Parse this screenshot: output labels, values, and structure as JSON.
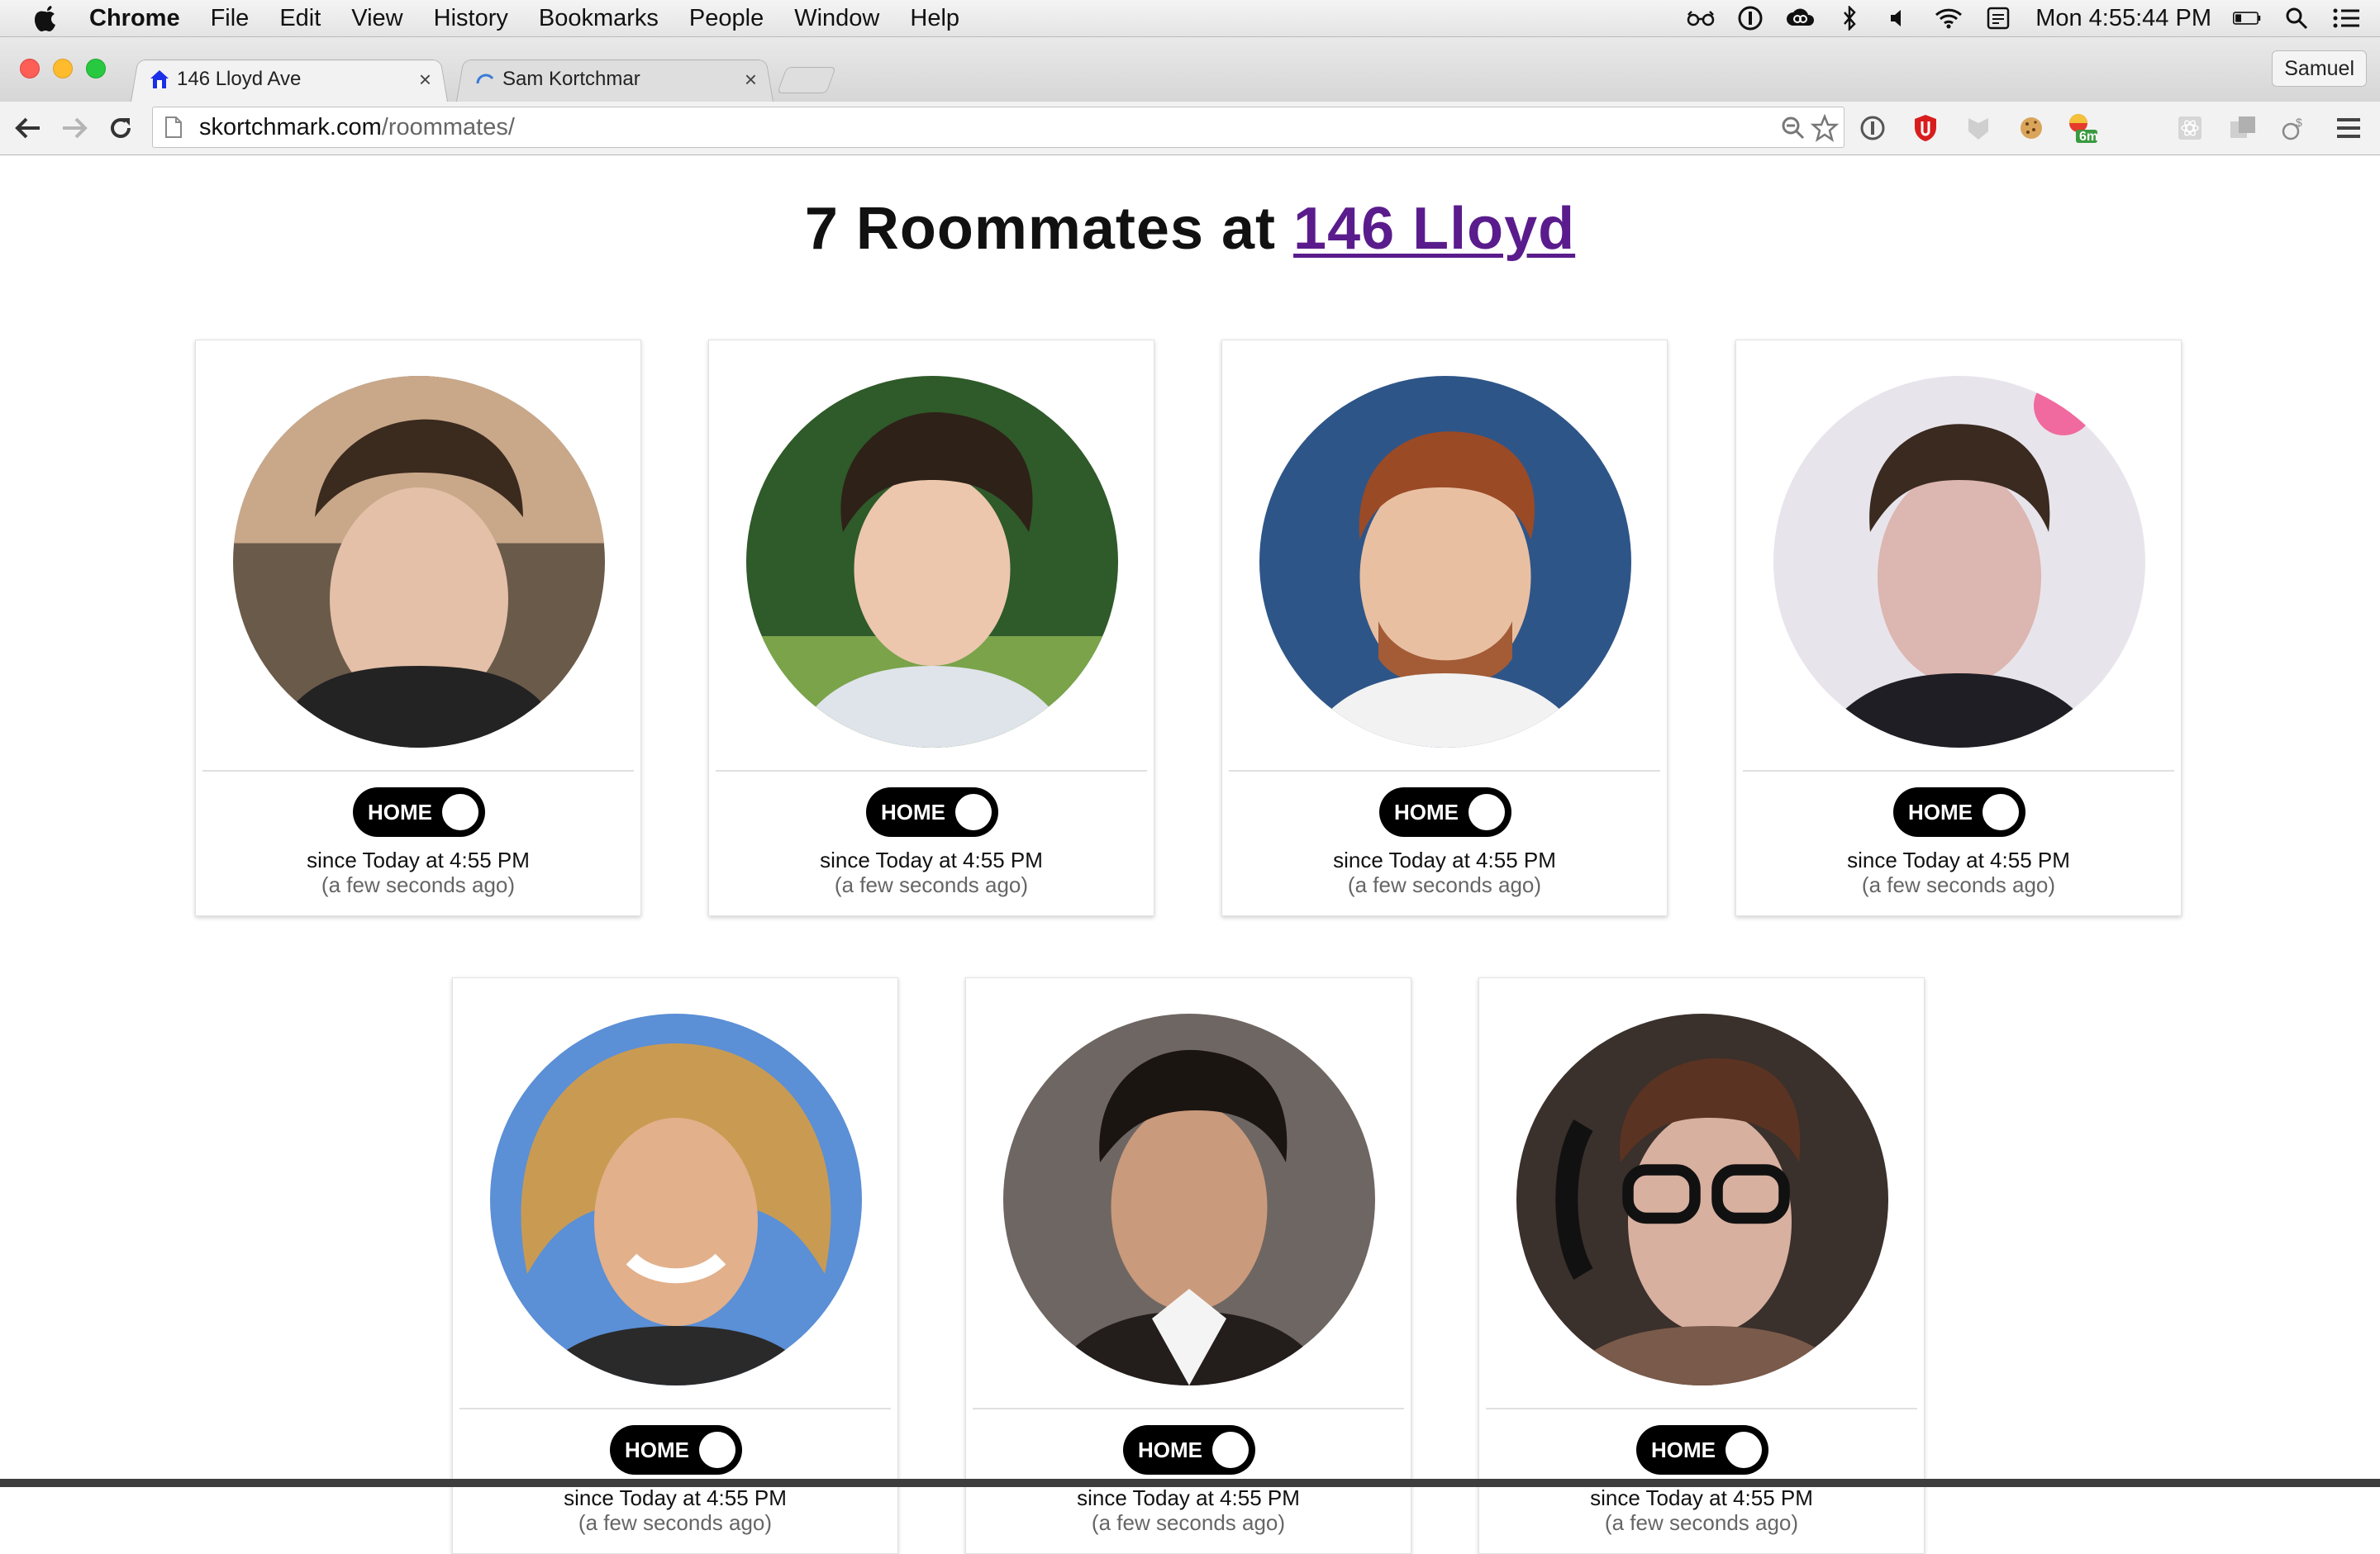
{
  "menubar": {
    "items": [
      "Chrome",
      "File",
      "Edit",
      "View",
      "History",
      "Bookmarks",
      "People",
      "Window",
      "Help"
    ],
    "clock": "Mon 4:55:44 PM"
  },
  "tabs": [
    {
      "title": "146 Lloyd Ave"
    },
    {
      "title": "Sam Kortchmar"
    }
  ],
  "profile_name": "Samuel",
  "omnibox": {
    "domain": "skortchmark.com",
    "path": "/roommates/"
  },
  "extensions": {
    "badge": "6m"
  },
  "page": {
    "title_prefix": "7 Roommates at ",
    "title_link": "146 Lloyd"
  },
  "roommates": [
    {
      "status": "HOME",
      "since": "since Today at 4:55 PM",
      "ago": "(a few seconds ago)"
    },
    {
      "status": "HOME",
      "since": "since Today at 4:55 PM",
      "ago": "(a few seconds ago)"
    },
    {
      "status": "HOME",
      "since": "since Today at 4:55 PM",
      "ago": "(a few seconds ago)"
    },
    {
      "status": "HOME",
      "since": "since Today at 4:55 PM",
      "ago": "(a few seconds ago)"
    },
    {
      "status": "HOME",
      "since": "since Today at 4:55 PM",
      "ago": "(a few seconds ago)"
    },
    {
      "status": "HOME",
      "since": "since Today at 4:55 PM",
      "ago": "(a few seconds ago)"
    },
    {
      "status": "HOME",
      "since": "since Today at 4:55 PM",
      "ago": "(a few seconds ago)"
    }
  ],
  "colors": {
    "link": "#5a1c8c",
    "toggle": "#000000",
    "close": "#fd5f57",
    "minimize": "#febb2e",
    "zoom": "#28c840"
  }
}
